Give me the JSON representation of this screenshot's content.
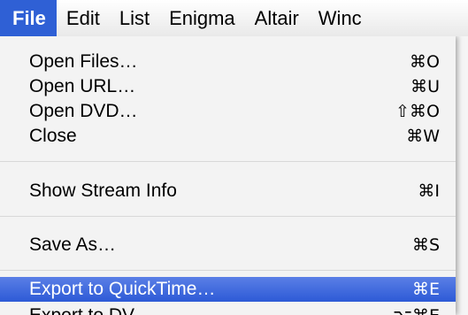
{
  "menubar": {
    "items": [
      {
        "label": "File"
      },
      {
        "label": "Edit"
      },
      {
        "label": "List"
      },
      {
        "label": "Enigma"
      },
      {
        "label": "Altair"
      },
      {
        "label": "Winc"
      }
    ]
  },
  "menu": {
    "items": [
      {
        "label": "Open Files…",
        "shortcut": "⌘O"
      },
      {
        "label": "Open URL…",
        "shortcut": "⌘U"
      },
      {
        "label": "Open DVD…",
        "shortcut": "⇧⌘O"
      },
      {
        "label": "Close",
        "shortcut": "⌘W"
      },
      {
        "label": "Show Stream Info",
        "shortcut": "⌘I"
      },
      {
        "label": "Save As…",
        "shortcut": "⌘S"
      },
      {
        "label": "Export to QuickTime…",
        "shortcut": "⌘E"
      },
      {
        "label": "Export to DV…",
        "shortcut": "⌥⌘E"
      }
    ]
  }
}
